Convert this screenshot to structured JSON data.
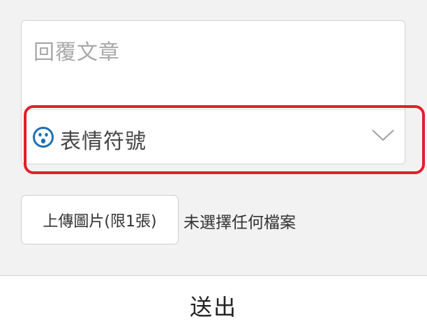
{
  "reply": {
    "placeholder": "回覆文章"
  },
  "emoji_select": {
    "label": "表情符號",
    "icon": "emoji-face-icon",
    "dropdown_icon": "chevron-down-icon",
    "icon_color": "#1f6fb2"
  },
  "highlight": {
    "color": "#e31e2c"
  },
  "upload": {
    "button_label": "上傳圖片(限1張)",
    "status_text": "未選擇任何檔案"
  },
  "submit": {
    "label": "送出"
  }
}
